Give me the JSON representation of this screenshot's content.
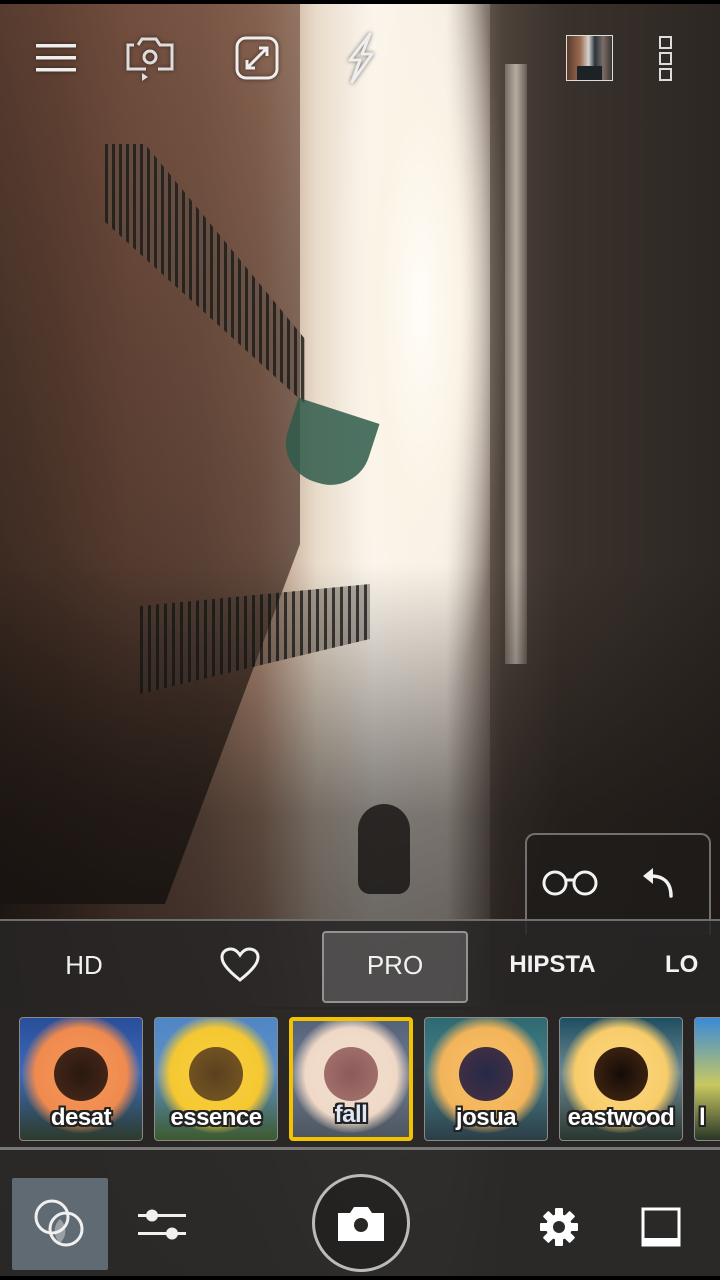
{
  "top_bar": {
    "menu_icon": "hamburger-menu-icon",
    "switch_camera_icon": "switch-camera-icon",
    "resize_icon": "aspect-resize-icon",
    "flash_icon": "flash-icon",
    "last_photo_icon": "gallery-thumbnail",
    "overflow_icon": "overflow-menu-icon"
  },
  "side_panel": {
    "glasses_icon": "glasses-icon",
    "undo_icon": "undo-arrow-icon"
  },
  "filter_categories": {
    "active": "PRO",
    "items": [
      {
        "label": "HD"
      },
      {
        "label": "",
        "icon": "heart-icon"
      },
      {
        "label": "PRO"
      },
      {
        "label": "HIPSTA"
      },
      {
        "label": "LO"
      }
    ]
  },
  "filters": {
    "selected": "fall",
    "items": [
      {
        "label": "desat"
      },
      {
        "label": "essence"
      },
      {
        "label": "fall"
      },
      {
        "label": "josua"
      },
      {
        "label": "eastwood"
      },
      {
        "label": "l"
      }
    ]
  },
  "bottom_bar": {
    "filters_mode_icon": "overlapping-circles-icon",
    "adjust_icon": "sliders-icon",
    "shutter_icon": "camera-icon",
    "settings_icon": "gear-icon",
    "frame_icon": "polaroid-frame-icon"
  },
  "colors": {
    "accent_selected": "#f3c300",
    "panel_bg": "#2c2b2a",
    "mode_active_bg": "#5f6a72"
  }
}
